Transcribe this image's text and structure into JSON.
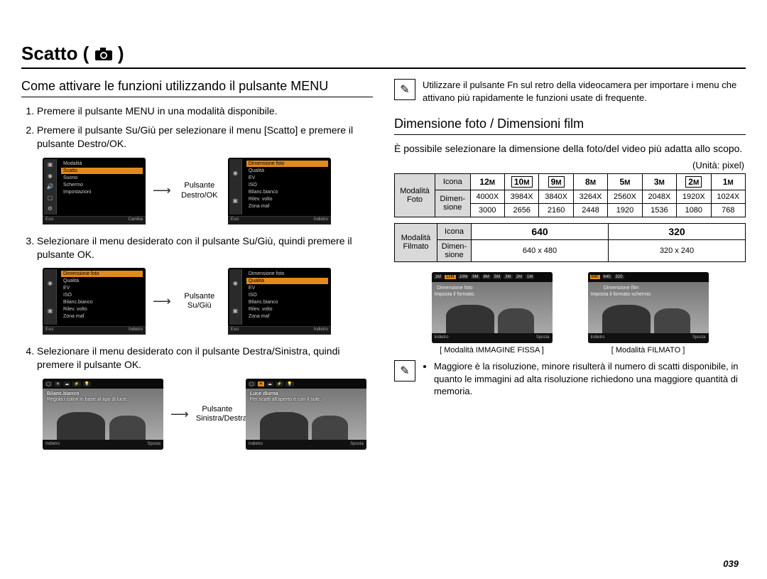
{
  "page": {
    "title_prefix": "Scatto (",
    "title_suffix": " )",
    "number": "039"
  },
  "left": {
    "heading": "Come attivare le funzioni utilizzando il pulsante MENU",
    "steps": [
      "Premere il pulsante MENU in una modalità disponibile.",
      "Premere il pulsante Su/Giù per selezionare il menu [Scatto] e premere il pulsante Destro/OK.",
      "Selezionare il menu desiderato con il pulsante Su/Giù, quindi premere il pulsante OK.",
      "Selezionare il menu desiderato con il pulsante Destra/Sinistra, quindi premere il pulsante OK."
    ],
    "captions": {
      "right_ok": "Pulsante Destro/OK",
      "up_down": "Pulsante Su/Giù",
      "left_right": "Pulsante Sinistra/Destra"
    },
    "menuA": {
      "items": [
        "Modalità",
        "Scatto",
        "Suono",
        "Schermo",
        "Impostazioni"
      ],
      "hl": 1,
      "right": [
        "Dimensione foto",
        "Qualità",
        "EV",
        "ISO",
        "Bilanc.bianco",
        "Rilev. volto",
        "Zona maf"
      ],
      "foot_l": "Esci",
      "foot_r": "Cambia"
    },
    "menuB": {
      "items": [
        "Dimensione foto",
        "Qualità",
        "EV",
        "ISO",
        "Bilanc.bianco",
        "Rilev. volto",
        "Zona maf"
      ],
      "hl": 0,
      "foot_l": "Esci",
      "foot_r": "Indietro"
    },
    "menuC": {
      "items": [
        "Dimensione foto",
        "Qualità",
        "EV",
        "ISO",
        "Bilanc.bianco",
        "Rilev. volto",
        "Zona maf"
      ],
      "hl": 1,
      "foot_l": "Esci",
      "foot_r": "Indietro"
    },
    "previewA": {
      "title": "Bilanc.bianco",
      "tip": "Regola i colori in base al tipo di luce.",
      "foot_l": "Indietro",
      "foot_r": "Sposta"
    },
    "previewB": {
      "title": "Luce diurna",
      "tip": "Per scatti all'aperto e con il sole.",
      "foot_l": "Indietro",
      "foot_r": "Sposta"
    }
  },
  "right": {
    "fn_note": "Utilizzare il pulsante Fn sul retro della videocamera per importare i menu che attivano più rapidamente le funzioni usate di frequente.",
    "heading": "Dimensione foto / Dimensioni film",
    "intro": "È possibile selezionare la dimensione della foto/del video più adatta allo scopo.",
    "unit": "(Unità: pixel)",
    "photo": {
      "rowhead": "Modalità Foto",
      "icon_label": "Icona",
      "dim_label1": "Dimen-",
      "dim_label2": "sione",
      "icons": [
        "12M",
        "10M",
        "9M",
        "8M",
        "5M",
        "3M",
        "2M",
        "1M"
      ],
      "boxed": [
        false,
        true,
        true,
        false,
        false,
        false,
        true,
        false
      ],
      "w": [
        "4000X",
        "3984X",
        "3840X",
        "3264X",
        "2560X",
        "2048X",
        "1920X",
        "1024X"
      ],
      "h": [
        "3000",
        "2656",
        "2160",
        "2448",
        "1920",
        "1536",
        "1080",
        "768"
      ]
    },
    "film": {
      "rowhead": "Modalità Filmato",
      "icon_label": "Icona",
      "dim_label1": "Dimen-",
      "dim_label2": "sione",
      "icons": [
        "640",
        "320"
      ],
      "dims": [
        "640 x 480",
        "320 x 240"
      ]
    },
    "shotF": {
      "bar": [
        "1M",
        "12M",
        "10M",
        "9M",
        "8M",
        "5M",
        "3M",
        "2M",
        "1M"
      ],
      "hl": 1,
      "lines": [
        "Dimensione foto",
        "Imposta il formato."
      ],
      "foot_l": "Indietro",
      "foot_r": "Sposta",
      "caption": "[ Modalità IMMAGINE FISSA ]"
    },
    "shotM": {
      "bar": [
        "640",
        "640",
        "320"
      ],
      "hl": 0,
      "lines": [
        "Dimensione film",
        "Imposta il formato schermo."
      ],
      "foot_l": "Indietro",
      "foot_r": "Sposta",
      "caption": "[ Modalità FILMATO ]"
    },
    "res_note": "Maggiore è la risoluzione, minore risulterà il numero di scatti disponibile, in quanto le immagini ad alta risoluzione richiedono una maggiore quantità di memoria."
  }
}
